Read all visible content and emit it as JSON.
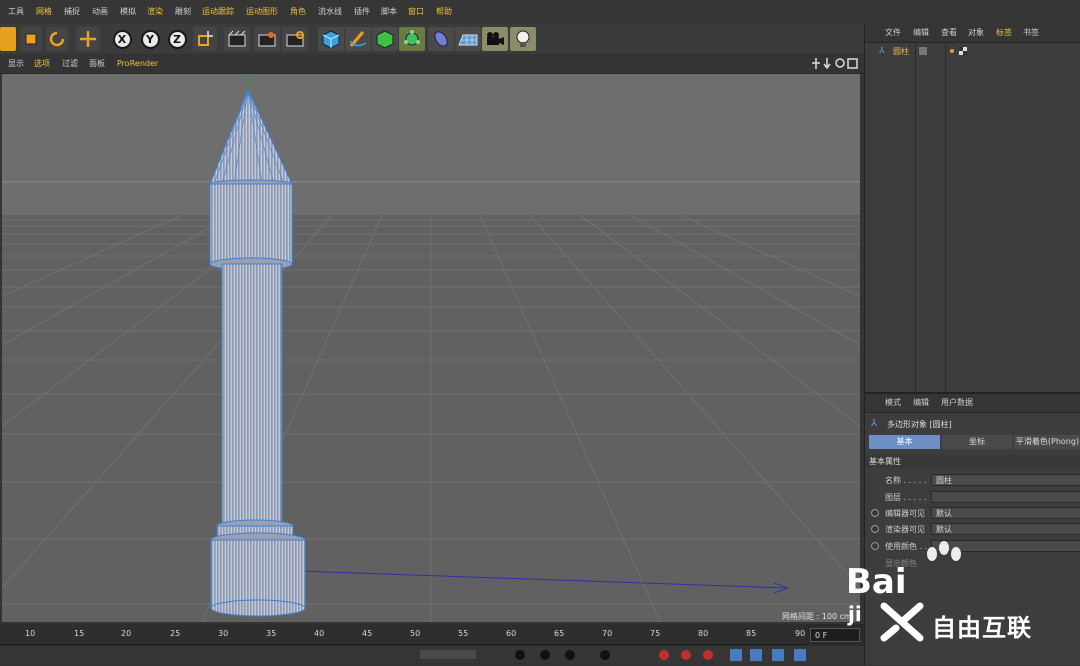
{
  "menu": [
    "工具",
    "网格",
    "捕捉",
    "动画",
    "模拟",
    "渲染",
    "雕刻",
    "运动跟踪",
    "运动图形",
    "角色",
    "流水线",
    "插件",
    "脚本",
    "窗口",
    "帮助"
  ],
  "toolbar": {
    "x_label": "X",
    "y_label": "Y",
    "z_label": "Z"
  },
  "viewport_menu": [
    "显示",
    "选项",
    "过滤",
    "面板",
    "ProRender"
  ],
  "viewport": {
    "grid_spacing": "网格间距 : 100 cm"
  },
  "timeline": {
    "ticks": [
      "10",
      "15",
      "20",
      "25",
      "30",
      "35",
      "40",
      "45",
      "50",
      "55",
      "60",
      "65",
      "70",
      "75",
      "80",
      "85",
      "90"
    ],
    "frame_field": "0 F"
  },
  "object_manager": {
    "tabs": [
      "文件",
      "编辑",
      "查看",
      "对象",
      "标签",
      "书签"
    ],
    "object_name": "圆柱"
  },
  "attribute_manager": {
    "tabs": [
      "模式",
      "编辑",
      "用户数据"
    ],
    "object_title": "多边形对象 [圆柱]",
    "subtabs": [
      "基本",
      "坐标",
      "平滑着色(Phong)"
    ],
    "section": "基本属性",
    "fields": [
      {
        "label": "名称 . . . . .",
        "value": "圆柱"
      },
      {
        "label": "图层 . . . . .",
        "value": ""
      },
      {
        "label": "编辑器可见",
        "value": "默认"
      },
      {
        "label": "渲染器可见",
        "value": "默认"
      },
      {
        "label": "使用颜色 . .",
        "value": ""
      },
      {
        "label": "显示颜色",
        "value": ""
      }
    ]
  },
  "watermark": {
    "text1": "Bai",
    "text2": "自由互联",
    "text3": "ji"
  },
  "colors": {
    "accent": "#f0c040",
    "wire": "#3f80d8",
    "active_tab": "#6d8fc4"
  }
}
